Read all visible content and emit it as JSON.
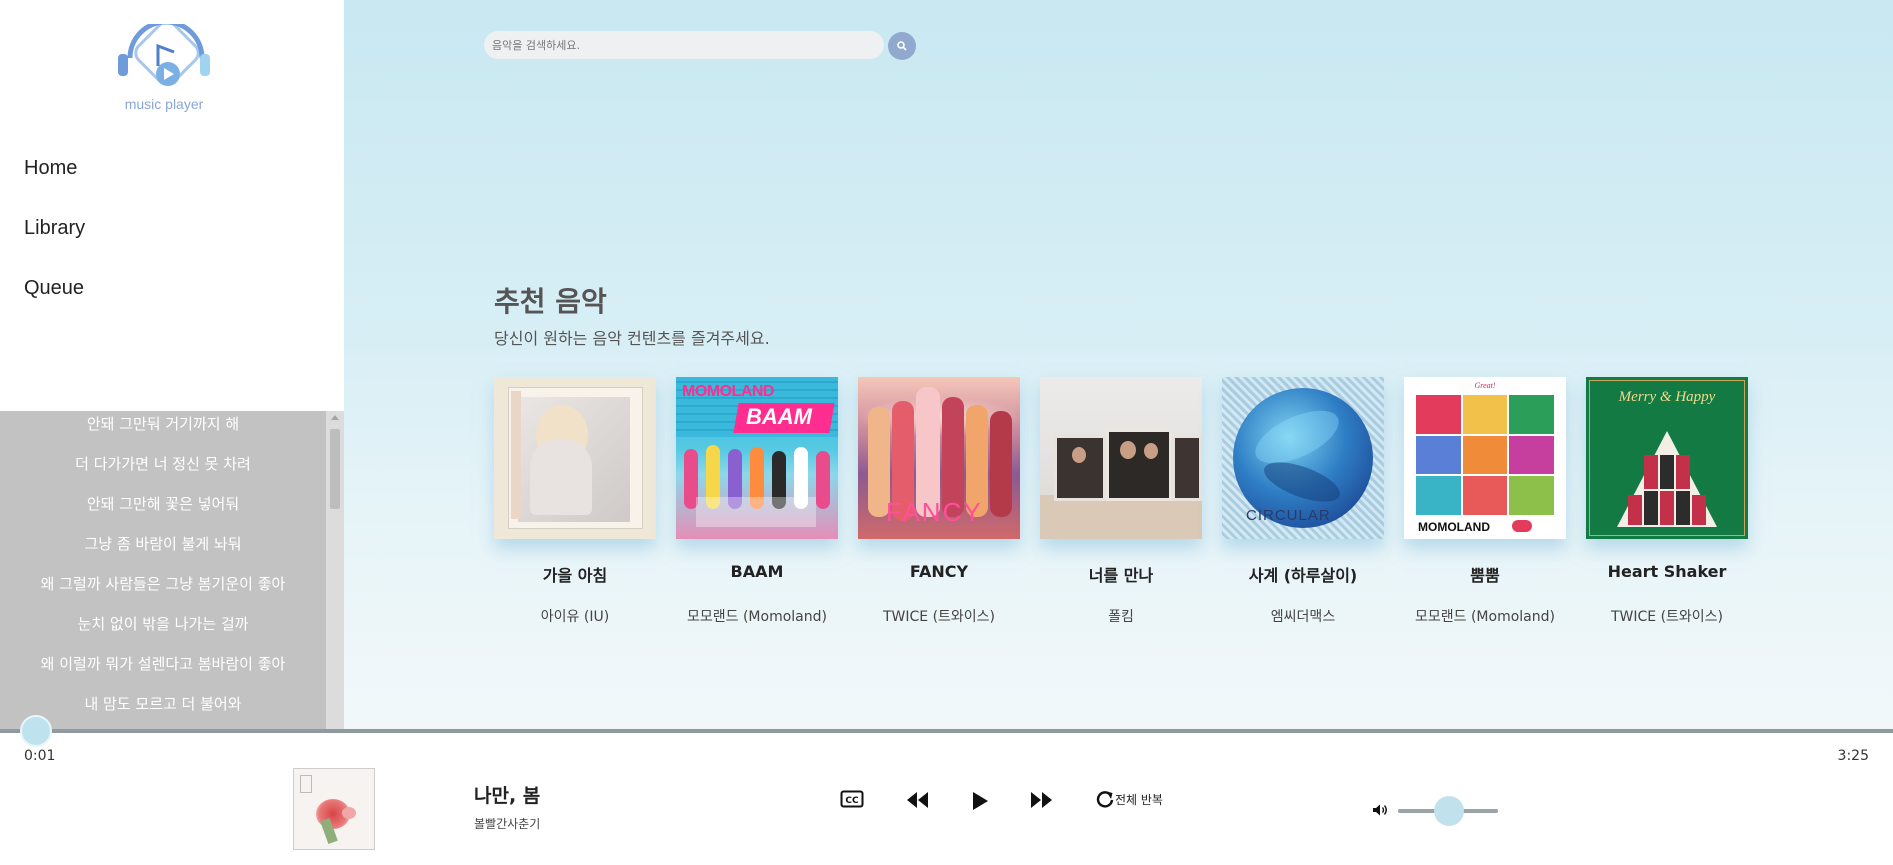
{
  "app": {
    "logo_text": "music player",
    "accent_color": "#92a9cf"
  },
  "sidebar": {
    "nav": [
      {
        "label": "Home"
      },
      {
        "label": "Library"
      },
      {
        "label": "Queue"
      }
    ]
  },
  "lyrics": [
    "안돼 그만둬 거기까지 해",
    "더 다가가면 너 정신 못 차려",
    "안돼 그만해 꽃은 넣어둬",
    "그냥 좀 바람이 불게 놔둬",
    "왜 그럴까 사람들은 그냥 봄기운이 좋아",
    "눈치 없이 밖을 나가는 걸까",
    "왜 이럴까 뭐가 설렌다고 봄바람이 좋아",
    "내 맘도 모르고 더 불어와"
  ],
  "search": {
    "placeholder": "음악을 검색하세요.",
    "button_icon": "search-icon"
  },
  "recommend": {
    "title": "추천 음악",
    "subtitle": "당신이 원하는 음악 컨텐츠를 즐겨주세요.",
    "albums": [
      {
        "title": "가을 아침",
        "artist": "아이유 (IU)"
      },
      {
        "title": "BAAM",
        "artist": "모모랜드 (Momoland)",
        "cover_text": "MOMOLAND BAAM"
      },
      {
        "title": "FANCY",
        "artist": "TWICE (트와이스)",
        "cover_text": "FANCY"
      },
      {
        "title": "너를 만나",
        "artist": "폴킴"
      },
      {
        "title": "사계 (하루살이)",
        "artist": "엠씨더맥스",
        "cover_text": "CIRCULAR"
      },
      {
        "title": "뿜뿜",
        "artist": "모모랜드 (Momoland)",
        "cover_text": "MOMOLAND"
      },
      {
        "title": "Heart Shaker",
        "artist": "TWICE (트와이스)",
        "cover_text": "Merry & Happy"
      }
    ]
  },
  "player": {
    "current_time": "0:01",
    "total_time": "3:25",
    "progress_fraction": 0.005,
    "title": "나만, 봄",
    "artist": "볼빨간사춘기",
    "repeat_label": "전체 반복",
    "volume_fraction": 0.5,
    "icons": [
      "cc-icon",
      "rewind-icon",
      "play-icon",
      "fast-forward-icon",
      "repeat-icon",
      "volume-icon"
    ]
  }
}
